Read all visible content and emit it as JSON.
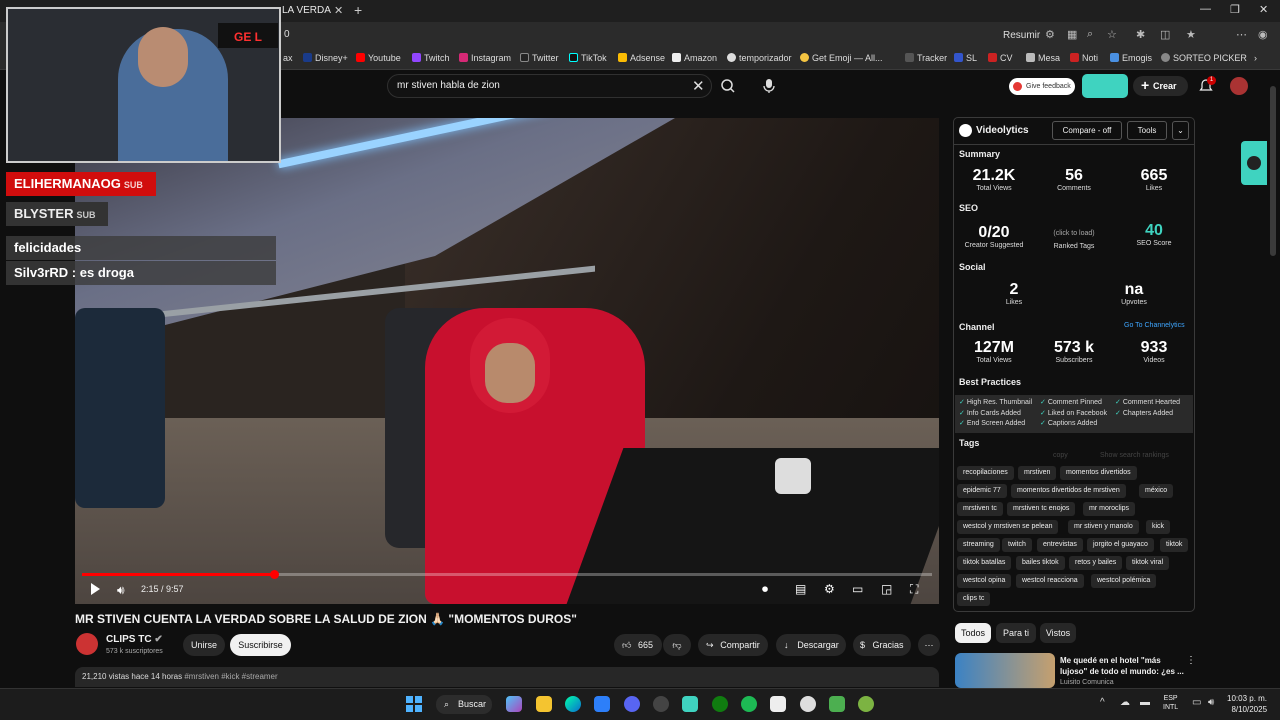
{
  "browser": {
    "tab_title": "LA VERDA",
    "address_text": "0",
    "resumir_label": "Resumir",
    "bookmarks": [
      "ax",
      "Disney+",
      "Youtube",
      "Twitch",
      "Instagram",
      "Twitter",
      "TikTok",
      "Adsense",
      "Amazon",
      "temporizador",
      "Get Emoji — All...",
      "Tracker",
      "SL",
      "CV",
      "Mesa",
      "Noti",
      "Emogis",
      "SORTEO PICKER"
    ]
  },
  "youtube": {
    "search_value": "mr stiven habla de zion",
    "feedback_label": "Give feedback",
    "crear_label": "Crear",
    "notif_count": "1"
  },
  "stream_overlay": {
    "cam_sign": "GE L",
    "chat": [
      {
        "user": "ELIHERMANAOG",
        "badge": "SUB"
      },
      {
        "user": "BLYSTER",
        "badge": "SUB"
      },
      {
        "text": "felicidades"
      },
      {
        "text": "Silv3rRD : es droga"
      }
    ]
  },
  "player": {
    "time": "2:15 / 9:57",
    "progress": 0.226
  },
  "video": {
    "title": "MR STIVEN CUENTA LA VERDAD SOBRE LA SALUD DE ZION 🙏🏻 \"MOMENTOS DUROS\"",
    "channel": "CLIPS TC",
    "subs": "573 k suscriptores",
    "unirse": "Unirse",
    "suscribirse": "Suscribirse",
    "likes": "665",
    "compartir": "Compartir",
    "descargar": "Descargar",
    "gracias": "Gracias",
    "views_date": "21,210 vistas  hace 14 horas",
    "hashtags": "#mrstiven #kick #streamer"
  },
  "videolytics": {
    "name": "Videolytics",
    "compare": "Compare - off",
    "tools": "Tools",
    "summary_label": "Summary",
    "summary": [
      {
        "value": "21.2K",
        "label": "Total Views"
      },
      {
        "value": "56",
        "label": "Comments"
      },
      {
        "value": "665",
        "label": "Likes"
      }
    ],
    "seo_label": "SEO",
    "seo": [
      {
        "value": "0/20",
        "label": "Creator Suggested"
      },
      {
        "value": "(click to load)",
        "label": "Ranked Tags"
      },
      {
        "value": "40",
        "label": "SEO Score"
      }
    ],
    "social_label": "Social",
    "social": [
      {
        "value": "2",
        "label": "Likes"
      },
      {
        "value": "na",
        "label": "Upvotes"
      }
    ],
    "channel_label": "Channel",
    "goto_channel": "Go To Channelytics",
    "channel": [
      {
        "value": "127M",
        "label": "Total Views"
      },
      {
        "value": "573 k",
        "label": "Subscribers"
      },
      {
        "value": "933",
        "label": "Videos"
      }
    ],
    "bp_label": "Best Practices",
    "best_practices": [
      "High Res. Thumbnail",
      "Comment Pinned",
      "Comment Hearted",
      "Info Cards Added",
      "Liked on Facebook",
      "Chapters Added",
      "End Screen Added",
      "Captions Added"
    ],
    "tags_label": "Tags",
    "copy_label": "copy",
    "show_rankings": "Show search rankings",
    "tags": [
      "recopilaciones",
      "mrstiven",
      "momentos divertidos",
      "epidemic 77",
      "momentos divertidos de mrstiven",
      "méxico",
      "mrstiven tc",
      "mrstiven tc enojos",
      "mr moroclips",
      "westcol y mrstiven se pelean",
      "mr stiven y manolo",
      "kick",
      "streaming",
      "twitch",
      "entrevistas",
      "jorgito el guayaco",
      "tiktok",
      "tiktok batallas",
      "bailes tiktok",
      "retos y bailes",
      "tiktok viral",
      "westcol opina",
      "westcol reacciona",
      "westcol polémica",
      "clips tc"
    ]
  },
  "recommend": {
    "filters": [
      "Todos",
      "Para ti",
      "Vistos"
    ],
    "title": "Me quedé en el hotel \"más lujoso\" de todo el mundo: ¿es ...",
    "channel": "Luisito Comunica"
  },
  "taskbar": {
    "search": "Buscar",
    "lang1": "ESP",
    "lang2": "INTL",
    "time": "10:03 p. m.",
    "date": "8/10/2025"
  }
}
